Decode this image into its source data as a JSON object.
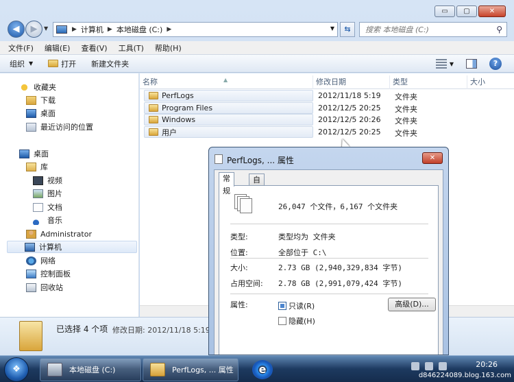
{
  "window": {
    "caption_min": "▭",
    "caption_max": "▢",
    "caption_close": "✕"
  },
  "nav": {
    "address": [
      "计算机",
      "本地磁盘 (C:)"
    ],
    "search_placeholder": "搜索 本地磁盘 (C:)"
  },
  "menu": [
    "文件(F)",
    "编辑(E)",
    "查看(V)",
    "工具(T)",
    "帮助(H)"
  ],
  "toolbar": {
    "organize": "组织",
    "open": "打开",
    "new_folder": "新建文件夹"
  },
  "sidebar": {
    "favorites": "收藏夹",
    "downloads": "下载",
    "desktop_fav": "桌面",
    "recent": "最近访问的位置",
    "desktop": "桌面",
    "libraries": "库",
    "video": "视频",
    "pictures": "图片",
    "documents": "文档",
    "music": "音乐",
    "user": "Administrator",
    "computer": "计算机",
    "network": "网络",
    "control_panel": "控制面板",
    "recycle_bin": "回收站"
  },
  "columns": {
    "name": "名称",
    "date": "修改日期",
    "type": "类型",
    "size": "大小"
  },
  "files": [
    {
      "name": "PerfLogs",
      "date": "2012/11/18 5:19",
      "type": "文件夹"
    },
    {
      "name": "Program Files",
      "date": "2012/12/5 20:25",
      "type": "文件夹"
    },
    {
      "name": "Windows",
      "date": "2012/12/5 20:26",
      "type": "文件夹"
    },
    {
      "name": "用户",
      "date": "2012/12/5 20:25",
      "type": "文件夹"
    }
  ],
  "details": {
    "selected": "已选择 4 个项",
    "modified": "修改日期: 2012/11/18 5:19"
  },
  "dialog": {
    "title": "PerfLogs, ... 属性",
    "close": "✕",
    "tab_general": "常规",
    "tab_custom": "自定义",
    "summary": "26,047 个文件，6,167 个文件夹",
    "type_label": "类型:",
    "type_value": "类型均为 文件夹",
    "location_label": "位置:",
    "location_value": "全部位于 C:\\",
    "size_label": "大小:",
    "size_value": "2.73 GB (2,940,329,834 字节)",
    "disk_label": "占用空间:",
    "disk_value": "2.78 GB (2,991,079,424 字节)",
    "attr_label": "属性:",
    "readonly": "只读(R)",
    "hidden": "隐藏(H)",
    "advanced": "高级(D)..."
  },
  "taskbar": {
    "start": "❖",
    "items": [
      "本地磁盘 (C:)",
      "PerfLogs, ... 属性"
    ],
    "ie": "e",
    "clock": "20:26",
    "watermark": "d846224089.blog.163.com"
  },
  "colors": {
    "accent": "#1e5aa8",
    "close_red": "#c7432a"
  }
}
